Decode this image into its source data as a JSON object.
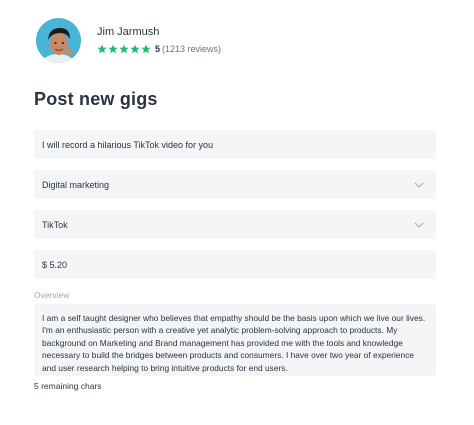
{
  "profile": {
    "name": "Jim Jarmush",
    "rating_value": "5",
    "rating_count": "(1213 reviews)",
    "stars": 5,
    "star_color": "#1dbf73"
  },
  "page": {
    "title": "Post new gigs"
  },
  "form": {
    "gig_title": "I will record a hilarious TikTok video for you",
    "category": "Digital marketing",
    "platform": "TikTok",
    "price": "$ 5.20",
    "overview_label": "Overview",
    "overview_text": "I am a self taught designer who believes that empathy should be the basis upon which we live our lives. I'm an enthusiastic person with a creative yet analytic problem-solving approach to products. My background on Marketing and Brand management has provided me with the tools and knowledge necessary to build the bridges between products and consumers. I have over two year of experience and user research helping to bring intuitive products for end users.",
    "remaining_chars": "5 remaining chars"
  },
  "icons": {
    "dropdown": "chevron-down-icon",
    "star": "star-icon"
  }
}
